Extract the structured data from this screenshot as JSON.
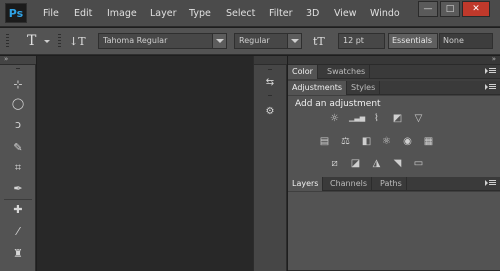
{
  "app": {
    "logo": "Ps"
  },
  "menu": [
    "File",
    "Edit",
    "Image",
    "Layer",
    "Type",
    "Select",
    "Filter",
    "3D",
    "View",
    "Windo"
  ],
  "window_controls": {
    "minimize": "—",
    "maximize": "□",
    "close": "✕"
  },
  "options": {
    "type_tool_glyph": "T",
    "orient_glyph": "↓T",
    "font_family": "Tahoma Regular",
    "font_style": "Regular",
    "size_glyph": "tT",
    "font_size": "12 pt",
    "workspace": "Essentials",
    "anti_alias": "None"
  },
  "tools": [
    "move-icon",
    "marquee-icon",
    "lasso-icon",
    "quick-select-icon",
    "crop-icon",
    "eyedropper-icon",
    "healing-brush-icon",
    "brush-icon",
    "clone-stamp-icon"
  ],
  "tool_glyphs": [
    "⊹",
    "◯",
    "ↄ",
    "✎",
    "⌗",
    "✒",
    "✚",
    "⁄",
    "♜"
  ],
  "strip_icons": [
    {
      "name": "history-icon",
      "glyph": "⇆"
    },
    {
      "name": "actions-icon",
      "glyph": "⚙"
    }
  ],
  "panel_color": {
    "tabs": [
      "Color",
      "Swatches"
    ]
  },
  "panel_adjustments": {
    "tabs": [
      "Adjustments",
      "Styles"
    ],
    "title": "Add an adjustment",
    "rows": [
      [
        "☼",
        "▁▃▅",
        "⌇",
        "◩",
        "▽"
      ],
      [
        "▤",
        "⚖",
        "◧",
        "⚛",
        "◉",
        "▦"
      ],
      [
        "⧄",
        "◪",
        "◮",
        "◥",
        "▭"
      ]
    ]
  },
  "panel_layers": {
    "tabs": [
      "Layers",
      "Channels",
      "Paths"
    ]
  }
}
